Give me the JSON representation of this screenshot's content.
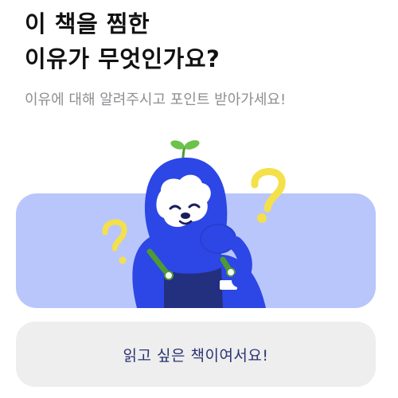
{
  "header": {
    "title_line1": "이 책을 찜한",
    "title_line2": "이유가 무엇인가요?",
    "subtitle": "이유에 대해 알려주시고 포인트 받아가세요!"
  },
  "banner": {
    "background_color": "#b8c6fb",
    "illustration": "blue-mascot-thinking-with-question-marks"
  },
  "answer_option": {
    "label": "읽고 싶은 책이여서요!"
  },
  "colors": {
    "mascot_body": "#2d46e6",
    "question_mark": "#f4e04a",
    "sprout": "#6cc24a",
    "overalls": "#23307f"
  }
}
